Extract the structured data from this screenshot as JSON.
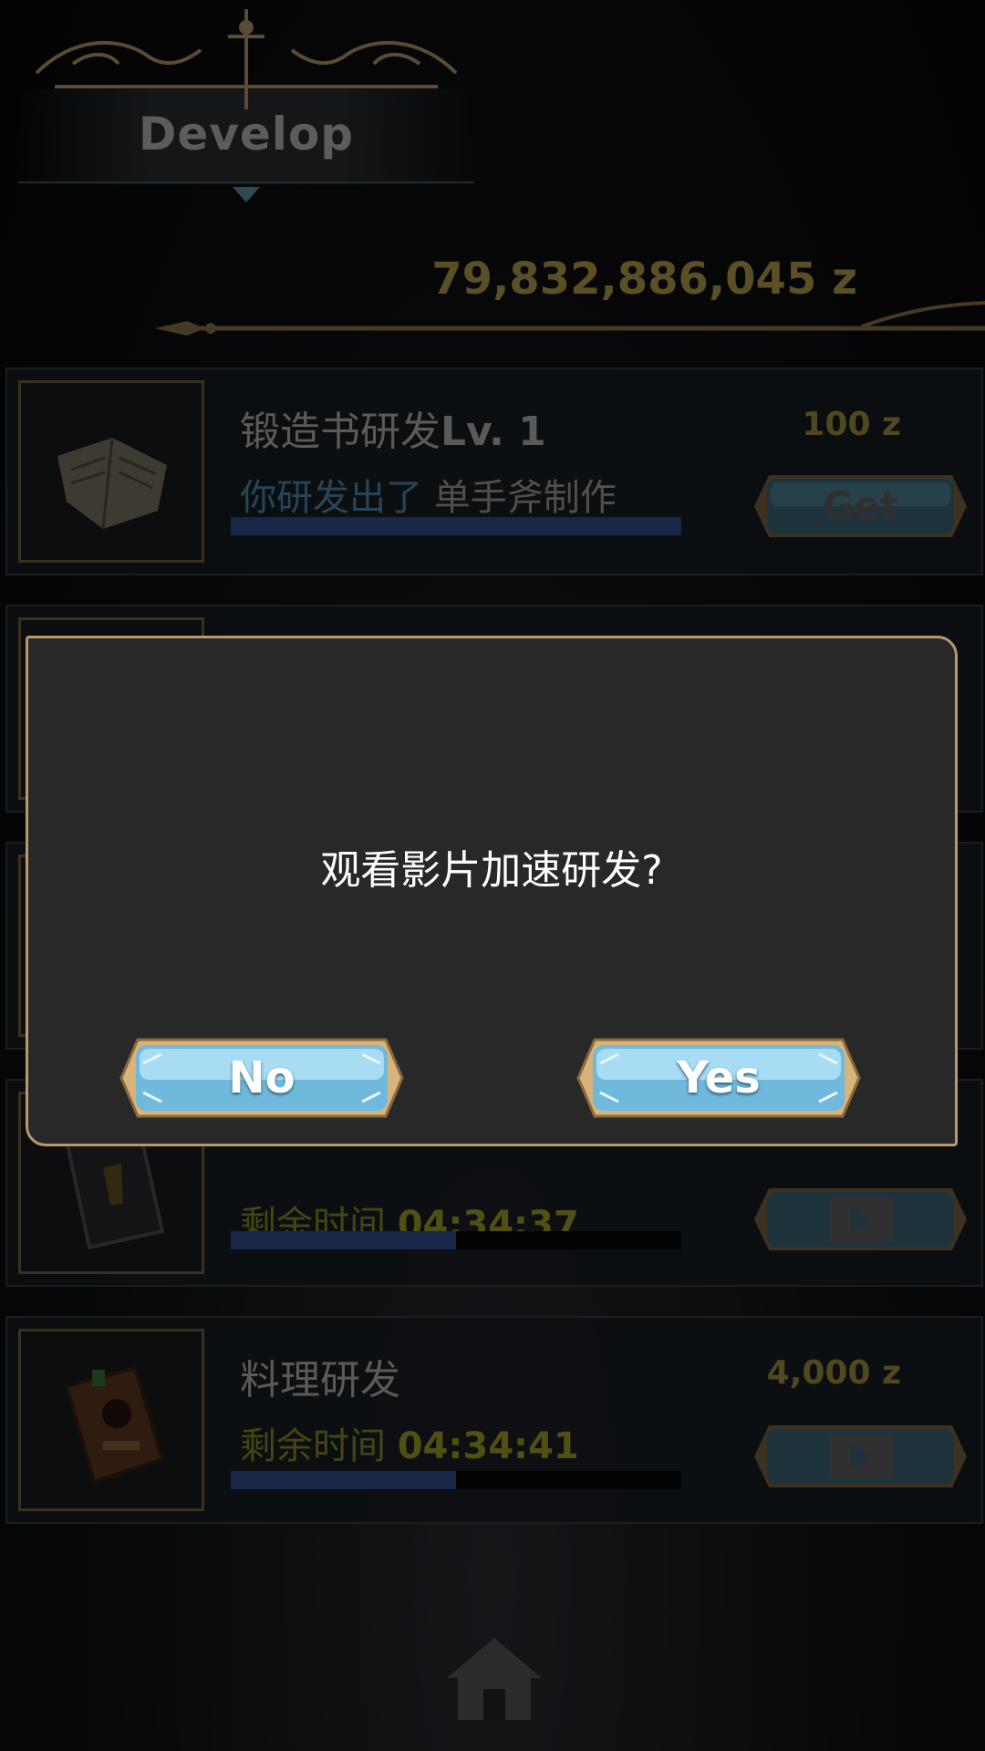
{
  "header": {
    "title": "Develop"
  },
  "currency": {
    "amount": "79,832,886,045 z"
  },
  "rows": [
    {
      "title": "锻造书研发",
      "level": "Lv. 1",
      "status_prefix": "你研发出了",
      "status_item": "单手斧制作",
      "price": "100 z",
      "button_label": "Get",
      "progress": 1.0
    },
    {
      "progress": 0.0
    },
    {
      "progress": 0.0
    },
    {
      "time_label": "剩余时间",
      "time_value": "04:34:37",
      "progress": 0.5,
      "button_icon": "video-play-icon"
    },
    {
      "title": "料理研发",
      "time_label": "剩余时间",
      "time_value": "04:34:41",
      "price": "4,000 z",
      "progress": 0.5,
      "button_icon": "video-play-icon"
    }
  ],
  "dialog": {
    "message": "观看影片加速研发?",
    "no_label": "No",
    "yes_label": "Yes"
  },
  "nav": {
    "home_icon": "home-icon"
  },
  "colors": {
    "gold_border": "#b89a6a",
    "button_blue": "#7fc8ea",
    "progress_blue": "#263b6e",
    "price_olive": "#7b7130"
  }
}
